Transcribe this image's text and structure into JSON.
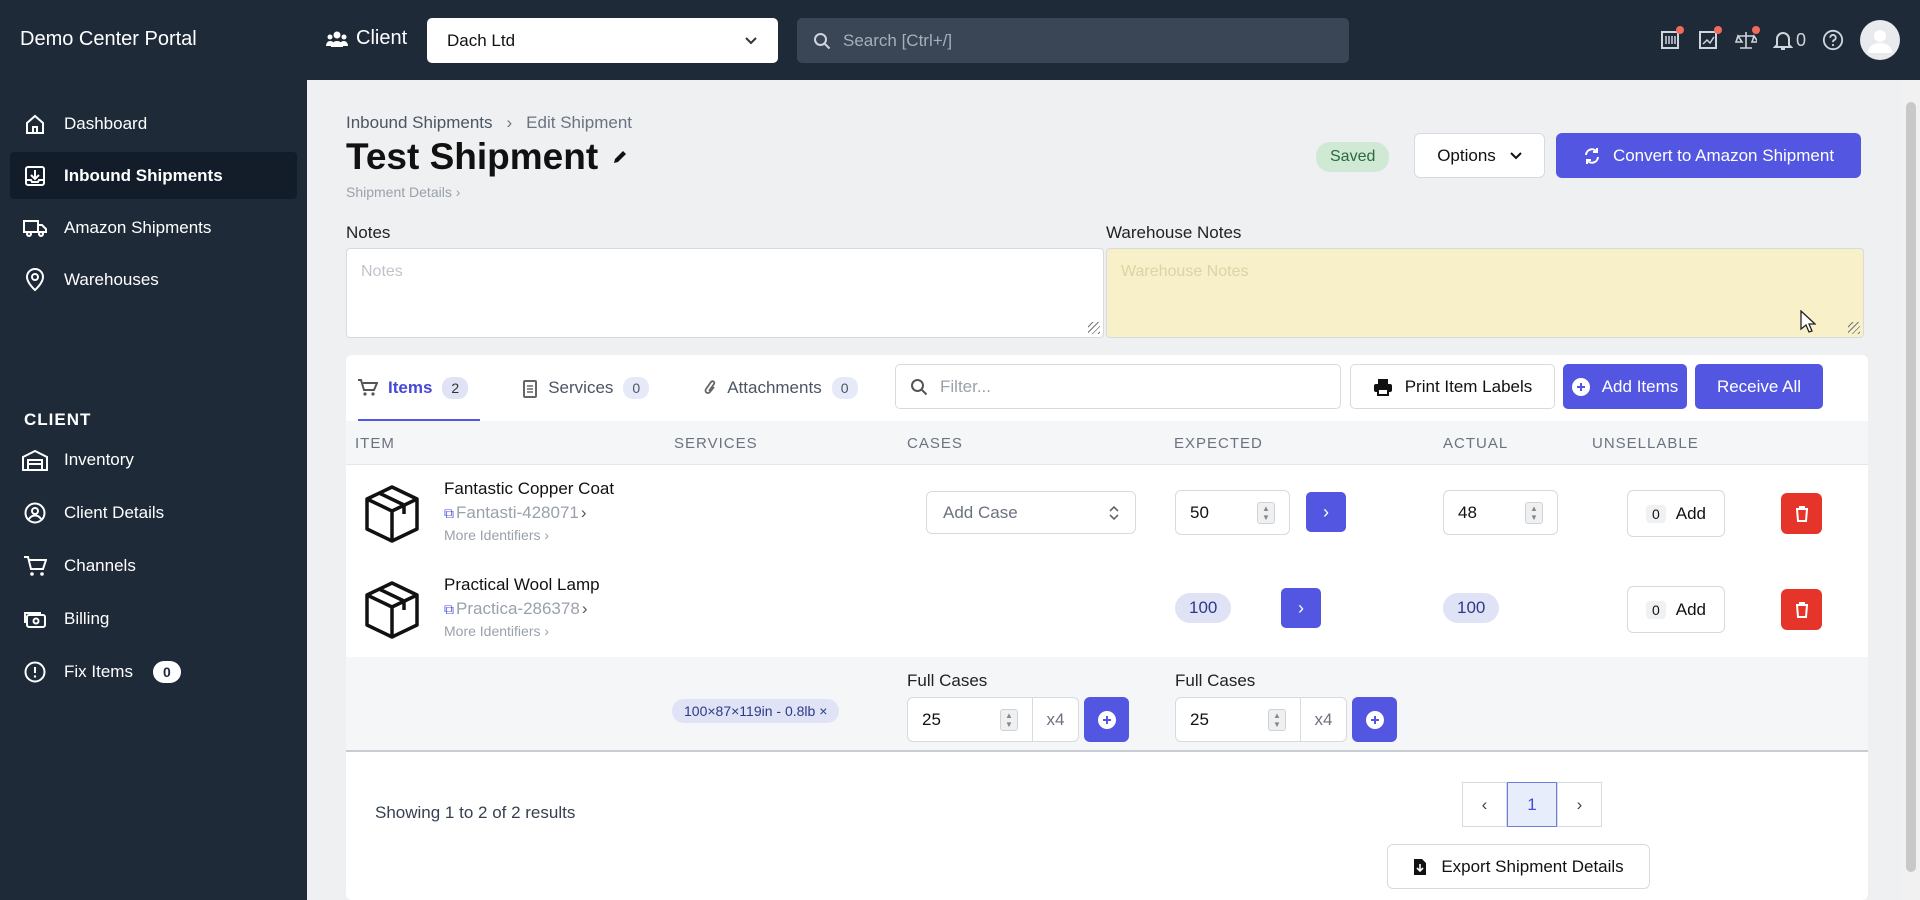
{
  "app": {
    "title": "Demo Center Portal"
  },
  "header": {
    "client_label": "Client",
    "client_value": "Dach Ltd",
    "search_placeholder": "Search [Ctrl+/]",
    "notification_count": "0"
  },
  "sidebar": {
    "items": [
      {
        "label": "Dashboard",
        "icon": "home-icon"
      },
      {
        "label": "Inbound Shipments",
        "icon": "inbox-download-icon",
        "active": true
      },
      {
        "label": "Amazon Shipments",
        "icon": "truck-icon"
      },
      {
        "label": "Warehouses",
        "icon": "map-pin-icon"
      }
    ],
    "section_label": "CLIENT",
    "client_items": [
      {
        "label": "Inventory",
        "icon": "warehouse-icon"
      },
      {
        "label": "Client Details",
        "icon": "user-circle-icon"
      },
      {
        "label": "Channels",
        "icon": "cart-icon"
      },
      {
        "label": "Billing",
        "icon": "cash-icon"
      },
      {
        "label": "Fix Items",
        "icon": "alert-circle-icon",
        "badge": "0"
      }
    ]
  },
  "page": {
    "breadcrumb": [
      "Inbound Shipments",
      "Edit Shipment"
    ],
    "title": "Test Shipment",
    "subtitle": "Shipment Details",
    "status": "Saved",
    "options_label": "Options",
    "convert_label": "Convert to Amazon Shipment",
    "notes_label": "Notes",
    "notes_placeholder": "Notes",
    "warehouse_notes_label": "Warehouse Notes",
    "warehouse_notes_placeholder": "Warehouse Notes"
  },
  "tabs": [
    {
      "label": "Items",
      "count": "2"
    },
    {
      "label": "Services",
      "count": "0"
    },
    {
      "label": "Attachments",
      "count": "0"
    }
  ],
  "toolbar": {
    "filter_placeholder": "Filter...",
    "print_label": "Print Item Labels",
    "add_items_label": "Add Items",
    "receive_all_label": "Receive All"
  },
  "table": {
    "headers": [
      "ITEM",
      "SERVICES",
      "CASES",
      "EXPECTED",
      "ACTUAL",
      "UNSELLABLE"
    ],
    "rows": [
      {
        "name": "Fantastic Copper Coat",
        "sku": "Fantasti-428071",
        "more": "More Identifiers",
        "cases_placeholder": "Add Case",
        "expected": "50",
        "actual": "48",
        "unsellable": "0",
        "add": "Add"
      },
      {
        "name": "Practical Wool Lamp",
        "sku": "Practica-286378",
        "more": "More Identifiers",
        "expected": "100",
        "actual": "100",
        "unsellable": "0",
        "add": "Add"
      }
    ],
    "case_row": {
      "dimensions": "100×87×119in - 0.8lb",
      "cases_label": "Full Cases",
      "cases_value": "25",
      "cases_mult": "x4",
      "expected_label": "Full Cases",
      "expected_value": "25",
      "expected_mult": "x4"
    }
  },
  "footer": {
    "showing": "Showing 1 to 2 of 2 results",
    "page": "1",
    "export_label": "Export Shipment Details"
  },
  "colors": {
    "primary": "#5256e0",
    "sidebar": "#1e2a38",
    "danger": "#e5352b",
    "saved": "#cfe9d4"
  }
}
